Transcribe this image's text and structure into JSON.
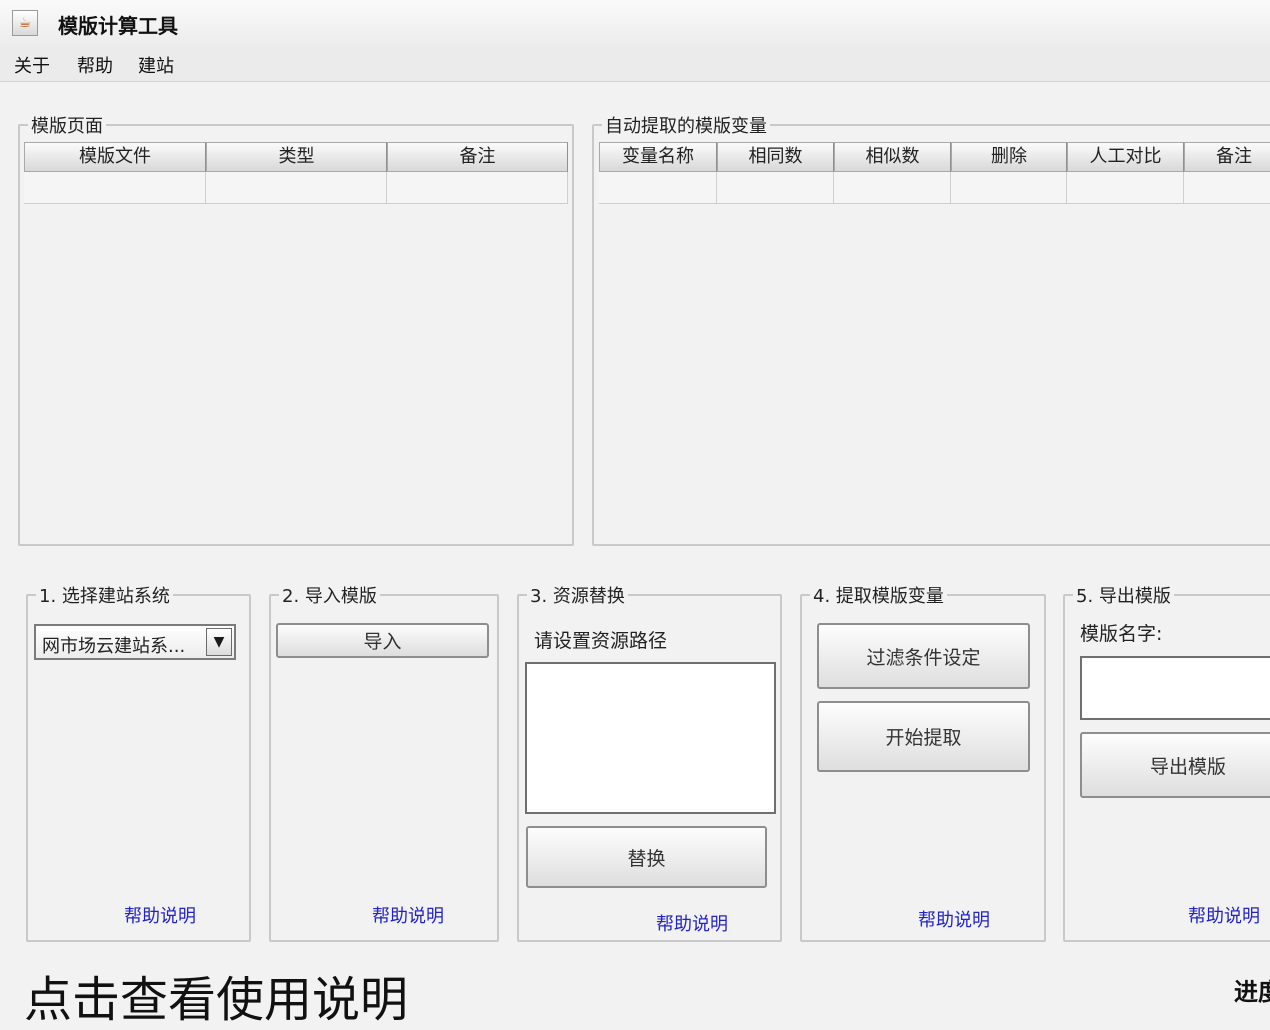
{
  "window": {
    "title": "模版计算工具",
    "icon": "java-cup-icon"
  },
  "menu": [
    "关于",
    "帮助",
    "建站"
  ],
  "template_panel": {
    "title": "模版页面",
    "columns": [
      "模版文件",
      "类型",
      "备注"
    ]
  },
  "variables_panel": {
    "title": "自动提取的模版变量",
    "columns": [
      "变量名称",
      "相同数",
      "相似数",
      "删除",
      "人工对比",
      "备注"
    ]
  },
  "step1": {
    "title": "1. 选择建站系统",
    "selected": "网市场云建站系...",
    "help": "帮助说明"
  },
  "step2": {
    "title": "2. 导入模版",
    "import_button": "导入",
    "help": "帮助说明"
  },
  "step3": {
    "title": "3. 资源替换",
    "path_label": "请设置资源路径",
    "path_value": "",
    "replace_button": "替换",
    "help": "帮助说明"
  },
  "step4": {
    "title": "4. 提取模版变量",
    "filter_button": "过滤条件设定",
    "extract_button": "开始提取",
    "help": "帮助说明"
  },
  "step5": {
    "title": "5. 导出模版",
    "name_label": "模版名字:",
    "name_value": "",
    "export_button": "导出模版",
    "help": "帮助说明"
  },
  "footer": {
    "help_text": "点击查看使用说明",
    "progress_label": "进度"
  },
  "colors": {
    "link": "#2323c8",
    "background": "#f2f2f2"
  }
}
